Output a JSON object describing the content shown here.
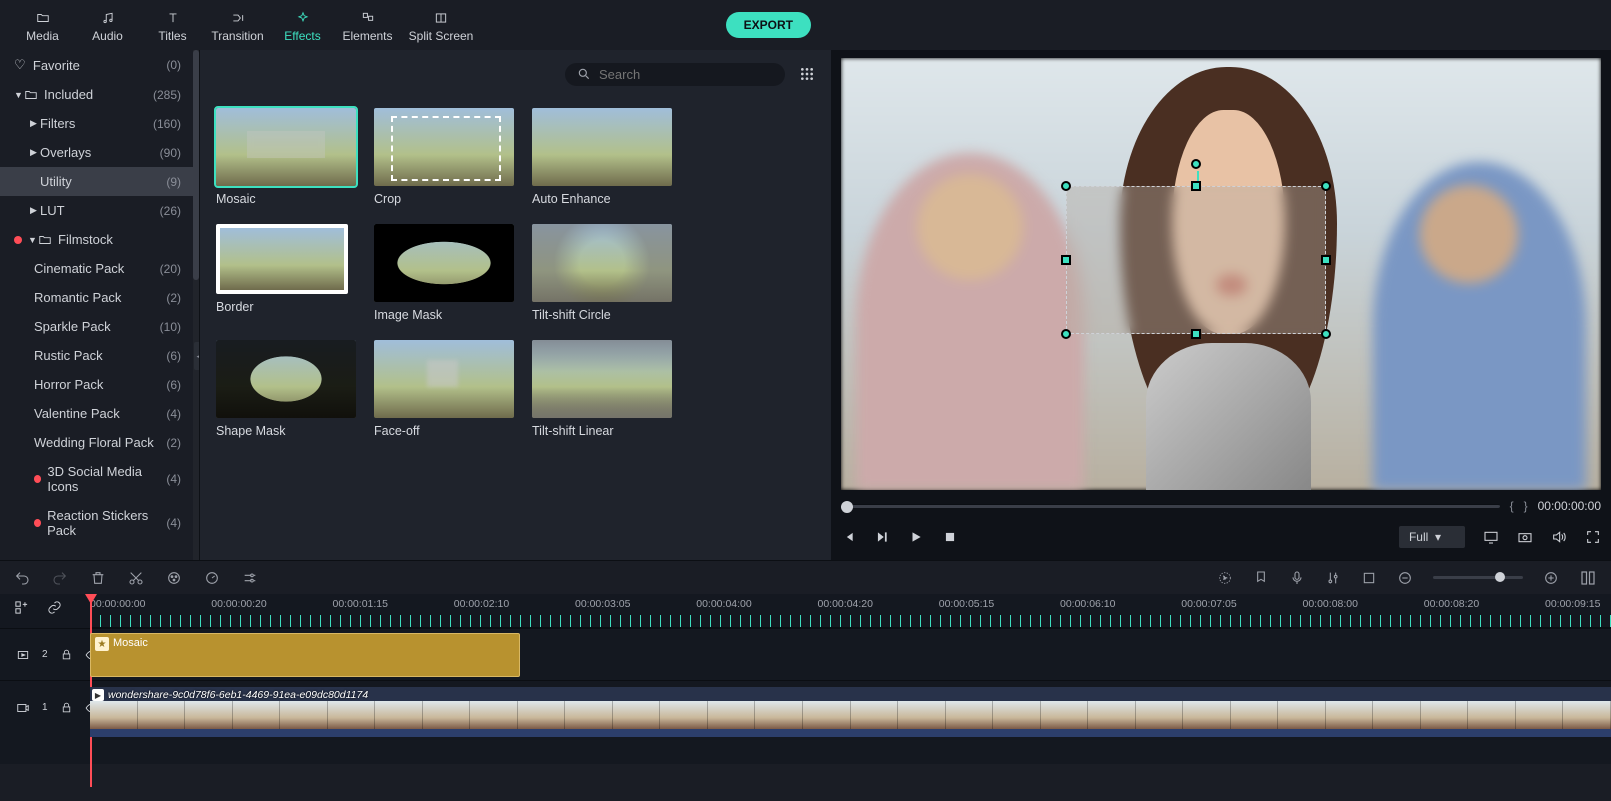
{
  "topbar": {
    "tabs": [
      "Media",
      "Audio",
      "Titles",
      "Transition",
      "Effects",
      "Elements",
      "Split Screen"
    ],
    "active": "Effects",
    "export": "EXPORT"
  },
  "sidebar": {
    "favorite": {
      "label": "Favorite",
      "count": "(0)"
    },
    "included": {
      "label": "Included",
      "count": "(285)"
    },
    "filters": {
      "label": "Filters",
      "count": "(160)"
    },
    "overlays": {
      "label": "Overlays",
      "count": "(90)"
    },
    "utility": {
      "label": "Utility",
      "count": "(9)"
    },
    "lut": {
      "label": "LUT",
      "count": "(26)"
    },
    "filmstock": {
      "label": "Filmstock"
    },
    "packs": [
      {
        "label": "Cinematic Pack",
        "count": "(20)",
        "dot": "none"
      },
      {
        "label": "Romantic Pack",
        "count": "(2)",
        "dot": "none"
      },
      {
        "label": "Sparkle Pack",
        "count": "(10)",
        "dot": "none"
      },
      {
        "label": "Rustic Pack",
        "count": "(6)",
        "dot": "none"
      },
      {
        "label": "Horror Pack",
        "count": "(6)",
        "dot": "none"
      },
      {
        "label": "Valentine Pack",
        "count": "(4)",
        "dot": "none"
      },
      {
        "label": "Wedding Floral Pack",
        "count": "(2)",
        "dot": "none"
      },
      {
        "label": "3D Social Media Icons",
        "count": "(4)",
        "dot": "red"
      },
      {
        "label": "Reaction Stickers Pack",
        "count": "(4)",
        "dot": "red"
      }
    ]
  },
  "library": {
    "search_placeholder": "Search",
    "items": [
      {
        "label": "Mosaic",
        "variant": "blur",
        "selected": true
      },
      {
        "label": "Crop",
        "variant": "crop"
      },
      {
        "label": "Auto Enhance",
        "variant": "plain"
      },
      {
        "label": "Border",
        "variant": "border"
      },
      {
        "label": "Image Mask",
        "variant": "mask-oval"
      },
      {
        "label": "Tilt-shift Circle",
        "variant": "tiltc"
      },
      {
        "label": "Shape Mask",
        "variant": "shape"
      },
      {
        "label": "Face-off",
        "variant": "faceoff"
      },
      {
        "label": "Tilt-shift Linear",
        "variant": "tiltl"
      }
    ]
  },
  "preview": {
    "braces_l": "{",
    "braces_r": "}",
    "timecode": "00:00:00:00",
    "quality": "Full"
  },
  "timeline": {
    "labels": [
      "00:00:00:00",
      "00:00:00:20",
      "00:00:01:15",
      "00:00:02:10",
      "00:00:03:05",
      "00:00:04:00",
      "00:00:04:20",
      "00:00:05:15",
      "00:00:06:10",
      "00:00:07:05",
      "00:00:08:00",
      "00:00:08:20",
      "00:00:09:15"
    ],
    "effect_clip": "Mosaic",
    "video_clip": "wondershare-9c0d78f6-6eb1-4469-91ea-e09dc80d1174"
  }
}
